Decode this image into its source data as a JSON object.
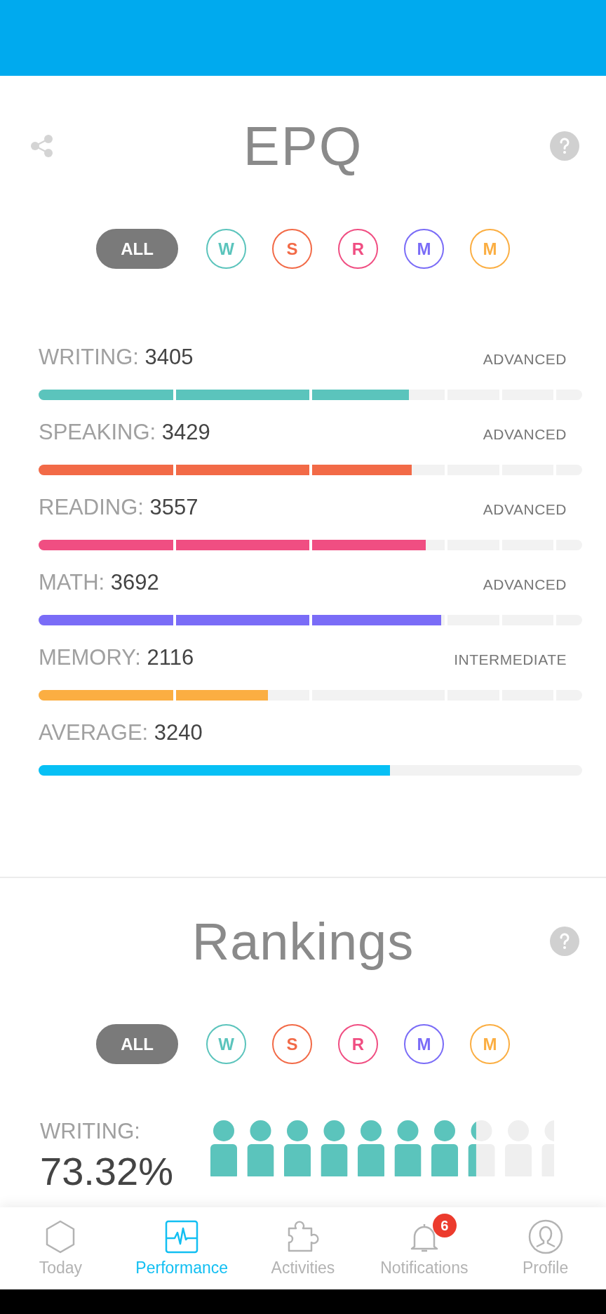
{
  "epq": {
    "title": "EPQ",
    "filters": [
      {
        "label": "ALL",
        "selected": true,
        "color": "#7a7a7a"
      },
      {
        "label": "W",
        "selected": false,
        "color": "#5bc4bc"
      },
      {
        "label": "S",
        "selected": false,
        "color": "#f26a47"
      },
      {
        "label": "R",
        "selected": false,
        "color": "#f04e82"
      },
      {
        "label": "M",
        "selected": false,
        "color": "#7a6cf7"
      },
      {
        "label": "M",
        "selected": false,
        "color": "#fbae42"
      }
    ],
    "skills": [
      {
        "name": "WRITING:",
        "score": "3405",
        "rating": "ADVANCED",
        "level": 0.681,
        "color": "#5bc4bc",
        "kind": "segmented"
      },
      {
        "name": "SPEAKING:",
        "score": "3429",
        "rating": "ADVANCED",
        "level": 0.686,
        "color": "#f26a47",
        "kind": "segmented"
      },
      {
        "name": "READING:",
        "score": "3557",
        "rating": "ADVANCED",
        "level": 0.712,
        "color": "#f04e82",
        "kind": "segmented"
      },
      {
        "name": "MATH:",
        "score": "3692",
        "rating": "ADVANCED",
        "level": 0.74,
        "color": "#7a6cf7",
        "kind": "segmented"
      },
      {
        "name": "MEMORY:",
        "score": "2116",
        "rating": "INTERMEDIATE",
        "level": 0.422,
        "color": "#fbae42",
        "kind": "segmented"
      },
      {
        "name": "AVERAGE:",
        "score": "3240",
        "level": 0.647,
        "color": "#07c0f5",
        "kind": "plain"
      }
    ]
  },
  "rankings": {
    "title": "Rankings",
    "filters": [
      {
        "label": "ALL",
        "selected": true,
        "color": "#7a7a7a"
      },
      {
        "label": "W",
        "selected": false,
        "color": "#5bc4bc"
      },
      {
        "label": "S",
        "selected": false,
        "color": "#f26a47"
      },
      {
        "label": "R",
        "selected": false,
        "color": "#f04e82"
      },
      {
        "label": "M",
        "selected": false,
        "color": "#7a6cf7"
      },
      {
        "label": "M",
        "selected": false,
        "color": "#fbae42"
      }
    ],
    "rows": [
      {
        "name": "WRITING:",
        "percent": "73.32%",
        "color": "#5bc4bc"
      }
    ]
  },
  "nav": [
    {
      "label": "Today",
      "kind": "hexagon",
      "selected": false
    },
    {
      "label": "Performance",
      "kind": "pulse",
      "selected": true
    },
    {
      "label": "Activities",
      "kind": "puzzle",
      "selected": false
    },
    {
      "label": "Notifications",
      "kind": "bell",
      "selected": false,
      "badge": "6"
    },
    {
      "label": "Profile",
      "kind": "person",
      "selected": false
    }
  ]
}
